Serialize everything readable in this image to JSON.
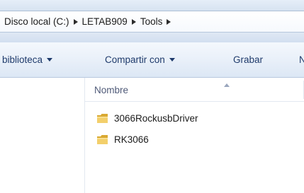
{
  "breadcrumb": {
    "items": [
      "Disco local (C:)",
      "LETAB909",
      "Tools"
    ]
  },
  "toolbar": {
    "library_label": "biblioteca",
    "share_label": "Compartir con",
    "burn_label": "Grabar",
    "truncated_label": "N"
  },
  "list": {
    "header_name": "Nombre",
    "items": [
      {
        "name": "3066RockusbDriver",
        "icon": "folder-icon"
      },
      {
        "name": "RK3066",
        "icon": "folder-icon"
      }
    ]
  },
  "colors": {
    "command_text": "#1e3a6b",
    "header_text": "#4f5a78",
    "folder": "#e8c15a"
  }
}
